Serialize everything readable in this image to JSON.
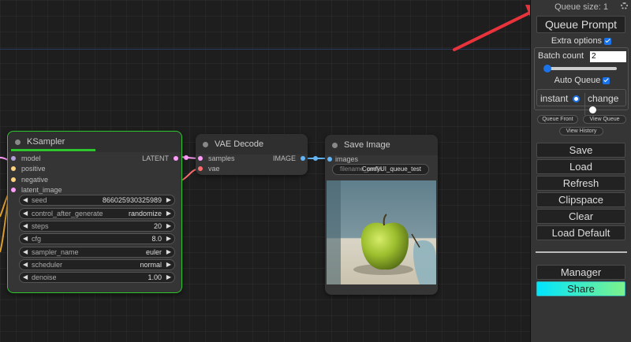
{
  "panel": {
    "queue_size": "Queue size: 1",
    "queue_prompt": "Queue Prompt",
    "extra_options": "Extra options",
    "batch_count_label": "Batch count",
    "batch_count_value": "2",
    "auto_queue": "Auto Queue",
    "instant": "instant",
    "change": "change",
    "queue_front": "Queue Front",
    "view_queue": "View Queue",
    "view_history": "View History",
    "save": "Save",
    "load": "Load",
    "refresh": "Refresh",
    "clipspace": "Clipspace",
    "clear": "Clear",
    "load_default": "Load Default",
    "manager": "Manager",
    "share": "Share"
  },
  "ksampler": {
    "title": "KSampler",
    "inputs": [
      "model",
      "positive",
      "negative",
      "latent_image"
    ],
    "output": "LATENT",
    "widgets": [
      {
        "label": "seed",
        "value": "866025930325989"
      },
      {
        "label": "control_after_generate",
        "value": "randomize"
      },
      {
        "label": "steps",
        "value": "20"
      },
      {
        "label": "cfg",
        "value": "8.0"
      },
      {
        "label": "sampler_name",
        "value": "euler"
      },
      {
        "label": "scheduler",
        "value": "normal"
      },
      {
        "label": "denoise",
        "value": "1.00"
      }
    ]
  },
  "vae_decode": {
    "title": "VAE Decode",
    "inputs": [
      "samples",
      "vae"
    ],
    "output": "IMAGE"
  },
  "save_image": {
    "title": "Save Image",
    "input": "images",
    "filename_label": "filename_prefix",
    "filename_value": "ComfyUI_queue_test"
  },
  "colors": {
    "accent_green": "#2ec52e",
    "share_gradient_start": "#00e5ff",
    "share_gradient_end": "#7df28a",
    "arrow": "#e8333c",
    "latent": "#ff9cf9",
    "image": "#64b5f6",
    "vae": "#ff6e6e"
  }
}
